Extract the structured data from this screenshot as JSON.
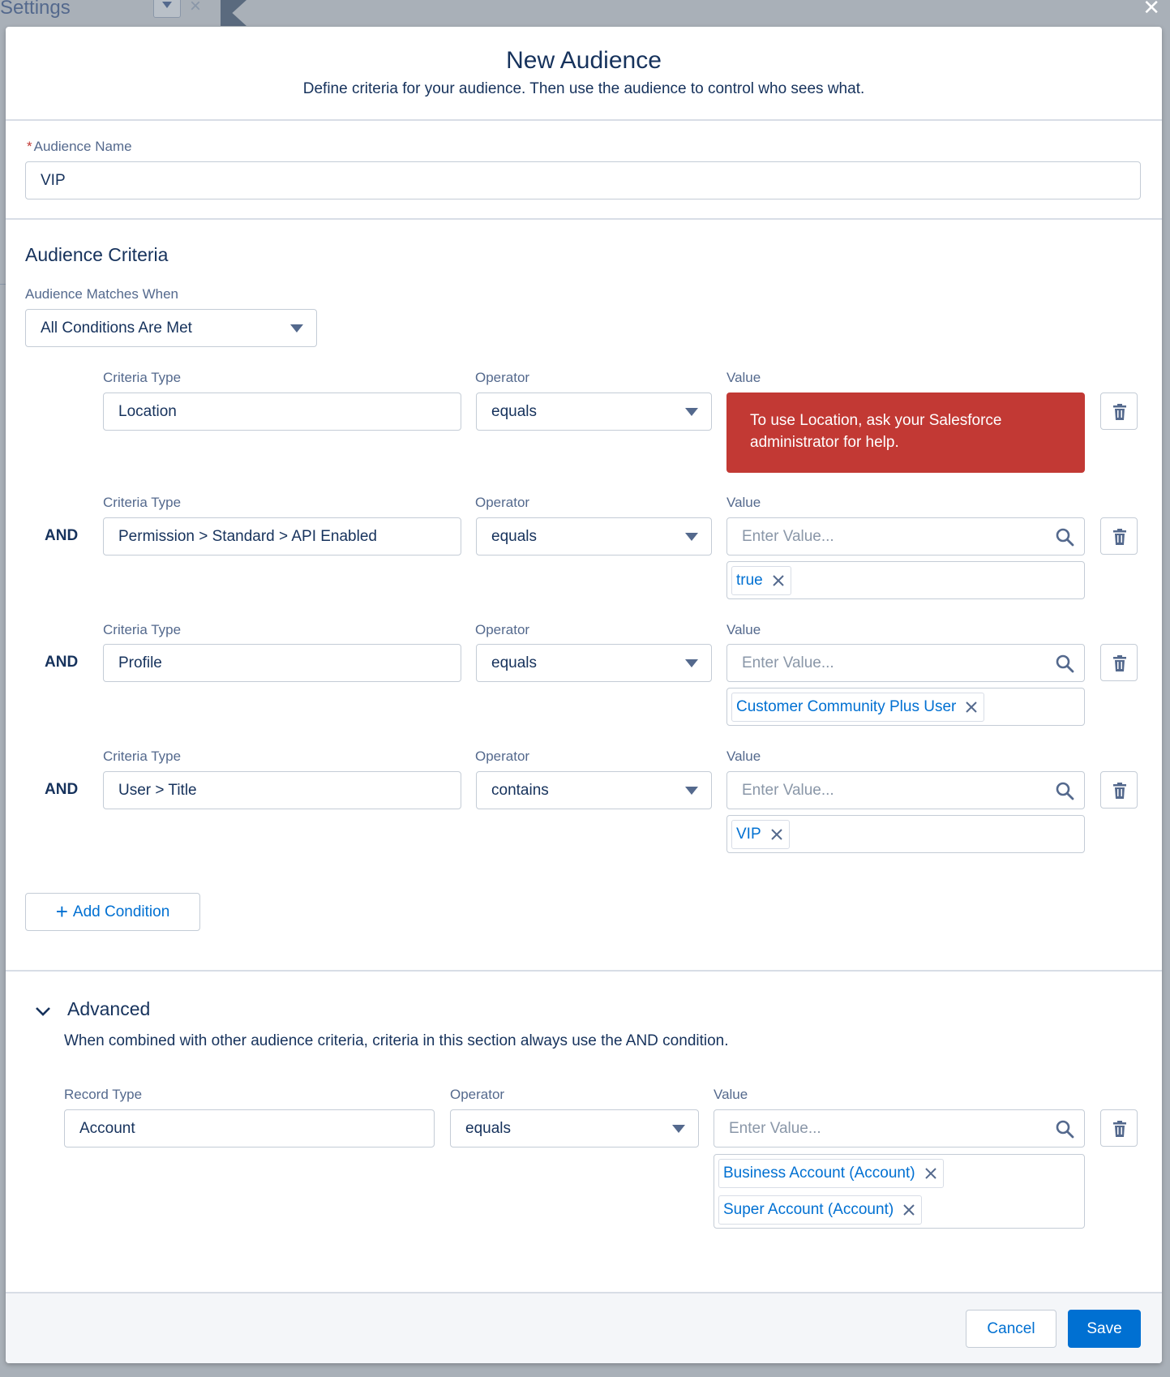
{
  "background": {
    "app_title": "Settings"
  },
  "modal": {
    "title": "New Audience",
    "subtitle": "Define criteria for your audience. Then use the audience to control who sees what.",
    "audience_name": {
      "label": "Audience Name",
      "required_mark": "*",
      "value": "VIP"
    },
    "criteria_section": {
      "heading": "Audience Criteria",
      "match_label": "Audience Matches When",
      "match_value": "All Conditions Are Met",
      "column_labels": {
        "type": "Criteria Type",
        "operator": "Operator",
        "value": "Value"
      },
      "conjunction": "AND",
      "rows": [
        {
          "type": "Location",
          "operator": "equals",
          "error": "To use Location, ask your Salesforce administrator for help."
        },
        {
          "type": "Permission > Standard > API Enabled",
          "operator": "equals",
          "placeholder": "Enter Value...",
          "pills": [
            "true"
          ]
        },
        {
          "type": "Profile",
          "operator": "equals",
          "placeholder": "Enter Value...",
          "pills": [
            "Customer Community Plus User"
          ]
        },
        {
          "type": "User > Title",
          "operator": "contains",
          "placeholder": "Enter Value...",
          "pills": [
            "VIP"
          ]
        }
      ],
      "add_condition": "Add Condition"
    },
    "advanced": {
      "heading": "Advanced",
      "description": "When combined with other audience criteria, criteria in this section always use the AND condition.",
      "column_labels": {
        "type": "Record Type",
        "operator": "Operator",
        "value": "Value"
      },
      "row": {
        "type": "Account",
        "operator": "equals",
        "placeholder": "Enter Value...",
        "pills": [
          "Business Account (Account)",
          "Super Account (Account)"
        ]
      }
    },
    "footer": {
      "cancel": "Cancel",
      "save": "Save"
    }
  },
  "colors": {
    "brand": "#0070d2",
    "error": "#c23934",
    "text": "#16325c",
    "label": "#54698d",
    "border": "#c4ccd6"
  }
}
